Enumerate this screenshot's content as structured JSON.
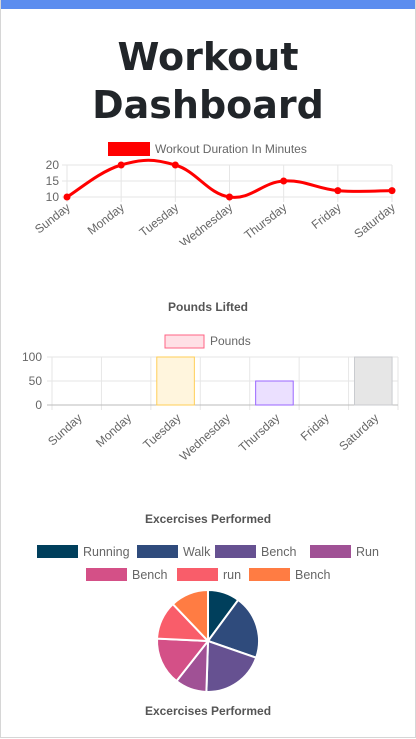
{
  "page": {
    "title": "Workout Dashboard"
  },
  "colors": {
    "topbar": "#5b8def",
    "line": "#ff0000",
    "grid": "#e6e6e6",
    "text": "#666666"
  },
  "chart_data": [
    {
      "type": "line",
      "title": "",
      "categories": [
        "Sunday",
        "Monday",
        "Tuesday",
        "Wednesday",
        "Thursday",
        "Friday",
        "Saturday"
      ],
      "series": [
        {
          "name": "Workout Duration In Minutes",
          "values": [
            10,
            20,
            20,
            10,
            15,
            12,
            12
          ],
          "color": "#ff0000"
        }
      ],
      "yticks": [
        10,
        15,
        20
      ],
      "ylim": [
        10,
        20
      ],
      "legend": "top",
      "grid": true
    },
    {
      "type": "bar",
      "title": "Pounds Lifted",
      "categories": [
        "Sunday",
        "Monday",
        "Tuesday",
        "Wednesday",
        "Thursday",
        "Friday",
        "Saturday"
      ],
      "series": [
        {
          "name": "Pounds",
          "values": [
            0,
            0,
            100,
            0,
            50,
            0,
            100
          ]
        }
      ],
      "bar_fills": [
        "#ffe0e6",
        "#d7ecfb",
        "#fff5dd",
        "#dbf2f2",
        "#ebe0ff",
        "#ffecd9",
        "#e6e6e6"
      ],
      "bar_strokes": [
        "#ff6384",
        "#36a2eb",
        "#ffce56",
        "#4bc0c0",
        "#9966ff",
        "#ff9f40",
        "#c9cbcf"
      ],
      "legend_fill": "#ffe0e6",
      "legend_stroke": "#ff6384",
      "yticks": [
        0,
        50,
        100
      ],
      "ylim": [
        0,
        100
      ],
      "legend": "top",
      "grid": true
    },
    {
      "type": "pie",
      "title": "Excercises Performed",
      "footer": "Excercises Performed",
      "labels": [
        "Running",
        "Walk",
        "Bench",
        "Run",
        "Bench",
        "run",
        "Bench"
      ],
      "values": [
        10,
        20,
        20,
        10,
        15,
        12,
        12
      ],
      "colors": [
        "#003f5c",
        "#2f4b7c",
        "#665191",
        "#a05195",
        "#d45087",
        "#f95d6a",
        "#ff7c43"
      ],
      "legend": "top"
    }
  ]
}
